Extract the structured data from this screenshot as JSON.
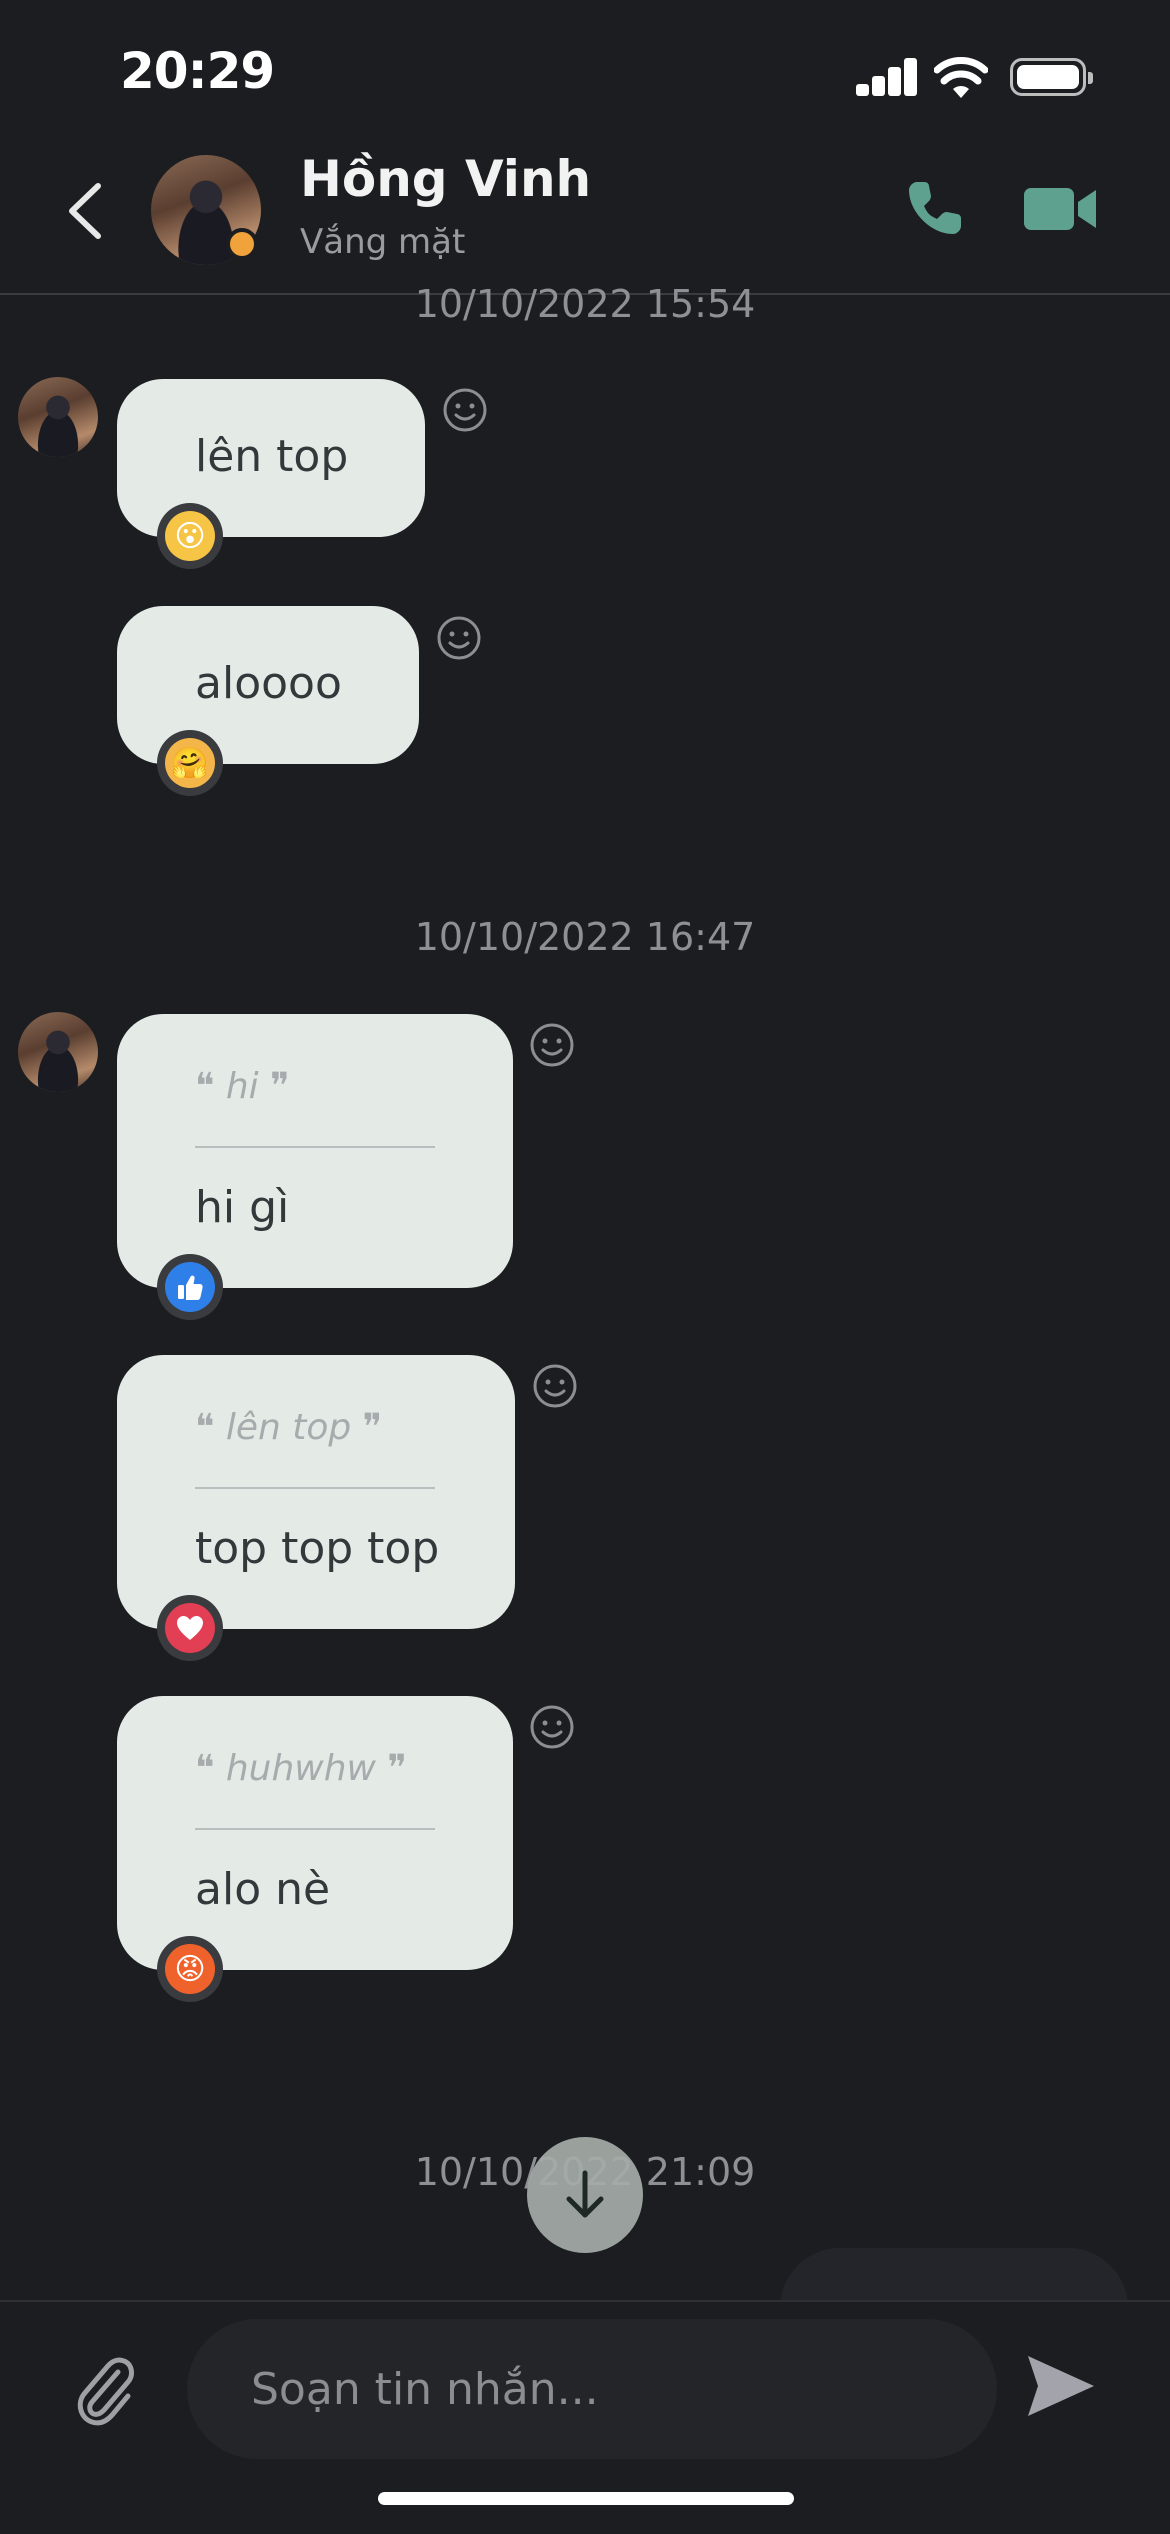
{
  "status_bar": {
    "time": "20:29"
  },
  "header": {
    "contact_name": "Hồng Vinh",
    "contact_status": "Vắng mặt",
    "icons": [
      "back-chevron-icon",
      "phone-icon",
      "video-camera-icon"
    ]
  },
  "colors": {
    "background": "#1c1d21",
    "bubble": "#e4ebe7",
    "accent": "#5fa18f",
    "away": "#f0a23b"
  },
  "chat": {
    "timestamps": [
      "10/10/2022 15:54",
      "10/10/2022 16:47",
      "10/10/2022 21:09"
    ],
    "messages": [
      {
        "text": "lên top",
        "reaction": "😮"
      },
      {
        "text": "aloooo",
        "reaction": "🤗"
      },
      {
        "quote": "❝ hi ❞",
        "text": "hi gì",
        "reaction": "like"
      },
      {
        "quote": "❝ lên top ❞",
        "text": "top top top",
        "reaction": "heart"
      },
      {
        "quote": "❝ huhwhw ❞",
        "text": "alo nè",
        "reaction": "😡"
      }
    ]
  },
  "composer": {
    "placeholder": "Soạn tin nhắn..."
  }
}
